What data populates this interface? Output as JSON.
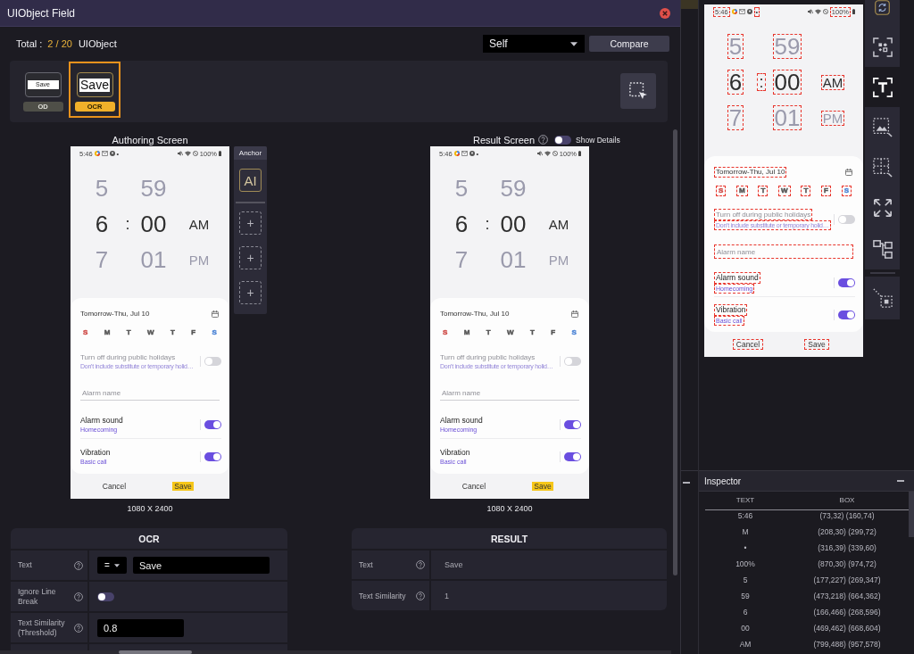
{
  "dialog": {
    "title": "UIObject Field",
    "total": {
      "label": "Total :",
      "count": "2 / 20",
      "unit": "UIObject"
    },
    "scope": {
      "value": "Self"
    },
    "compare_button": "Compare",
    "objects": [
      {
        "kind": "od",
        "image_text": "Save",
        "label": "OD",
        "selected": false
      },
      {
        "kind": "ocr",
        "image_text": "Save",
        "label": "OCR",
        "selected": true
      }
    ],
    "authoring": {
      "title": "Authoring Screen",
      "screen": {
        "ocr_boxes": false,
        "status": {
          "time": "5:46",
          "dot": "•",
          "battery": "100%"
        },
        "picker": {
          "separator": ":",
          "rows": [
            {
              "selected": false,
              "hour": "5",
              "minute": "59"
            },
            {
              "selected": true,
              "hour": "6",
              "minute": "00",
              "period": "AM"
            },
            {
              "selected": false,
              "hour": "7",
              "minute": "01",
              "period": "PM"
            }
          ]
        },
        "date": "Tomorrow-Thu, Jul 10",
        "days": [
          {
            "label": "S",
            "color": "#d0504c"
          },
          {
            "label": "M",
            "color": "#555555"
          },
          {
            "label": "T",
            "color": "#555555"
          },
          {
            "label": "W",
            "color": "#555555"
          },
          {
            "label": "T",
            "color": "#555555"
          },
          {
            "label": "F",
            "color": "#555555"
          },
          {
            "label": "S",
            "color": "#4f86d6"
          }
        ],
        "holiday": {
          "title": "Turn off during public holidays",
          "subtitle": "Don't include substitute or temporary holid…",
          "on": false,
          "disabled": true
        },
        "name_field": {
          "placeholder": "Alarm name"
        },
        "settings": [
          {
            "title": "Alarm sound",
            "subtitle": "Homecoming",
            "on": true
          },
          {
            "title": "Vibration",
            "subtitle": "Basic call",
            "on": true
          }
        ],
        "buttons": [
          {
            "label": "Cancel",
            "highlighted": false
          },
          {
            "label": "Save",
            "highlighted": true
          }
        ]
      },
      "resolution": "1080 X 2400"
    },
    "anchor": {
      "title": "Anchor",
      "ai_label": "AI",
      "slots": [
        "+",
        "+",
        "+"
      ]
    },
    "result": {
      "title": "Result Screen",
      "show_details": {
        "label": "Show Details",
        "on": false
      },
      "screen": {
        "ocr_boxes": false,
        "status": {
          "time": "5:46",
          "dot": "•",
          "battery": "100%"
        },
        "picker": {
          "separator": ":",
          "rows": [
            {
              "selected": false,
              "hour": "5",
              "minute": "59"
            },
            {
              "selected": true,
              "hour": "6",
              "minute": "00",
              "period": "AM"
            },
            {
              "selected": false,
              "hour": "7",
              "minute": "01",
              "period": "PM"
            }
          ]
        },
        "date": "Tomorrow-Thu, Jul 10",
        "days": [
          {
            "label": "S",
            "color": "#d0504c"
          },
          {
            "label": "M",
            "color": "#555555"
          },
          {
            "label": "T",
            "color": "#555555"
          },
          {
            "label": "W",
            "color": "#555555"
          },
          {
            "label": "T",
            "color": "#555555"
          },
          {
            "label": "F",
            "color": "#555555"
          },
          {
            "label": "S",
            "color": "#4f86d6"
          }
        ],
        "holiday": {
          "title": "Turn off during public holidays",
          "subtitle": "Don't include substitute or temporary holid…",
          "on": false,
          "disabled": true
        },
        "name_field": {
          "placeholder": "Alarm name"
        },
        "settings": [
          {
            "title": "Alarm sound",
            "subtitle": "Homecoming",
            "on": true
          },
          {
            "title": "Vibration",
            "subtitle": "Basic call",
            "on": true
          }
        ],
        "buttons": [
          {
            "label": "Cancel",
            "highlighted": false
          },
          {
            "label": "Save",
            "highlighted": true
          }
        ]
      },
      "resolution": "1080 X 2400"
    },
    "ocr_panel": {
      "title": "OCR",
      "rows": [
        {
          "kind": "operator_text",
          "label": "Text",
          "operator": "=",
          "value": "Save"
        },
        {
          "kind": "toggle",
          "label": "Ignore Line Break",
          "on": false
        },
        {
          "kind": "input",
          "label": "Text Similarity (Threshold)",
          "value": "0.8"
        }
      ]
    },
    "result_panel": {
      "title": "RESULT",
      "rows": [
        {
          "label": "Text",
          "value": "Save"
        },
        {
          "label": "Text Similarity",
          "value": "1"
        }
      ]
    }
  },
  "device": {
    "screen": {
      "ocr_boxes": true,
      "status": {
        "time": "5:46",
        "dot": "•",
        "battery": "100%"
      },
      "picker": {
        "separator": ":",
        "rows": [
          {
            "selected": false,
            "hour": "5",
            "minute": "59"
          },
          {
            "selected": true,
            "hour": "6",
            "minute": "00",
            "period": "AM"
          },
          {
            "selected": false,
            "hour": "7",
            "minute": "01",
            "period": "PM"
          }
        ]
      },
      "date": "Tomorrow-Thu, Jul 10",
      "days": [
        {
          "label": "S",
          "color": "#d0504c"
        },
        {
          "label": "M",
          "color": "#555555"
        },
        {
          "label": "T",
          "color": "#555555"
        },
        {
          "label": "W",
          "color": "#555555"
        },
        {
          "label": "T",
          "color": "#555555"
        },
        {
          "label": "F",
          "color": "#555555"
        },
        {
          "label": "S",
          "color": "#4f86d6"
        }
      ],
      "holiday": {
        "title": "Turn off during public holidays",
        "subtitle": "Don't include substitute or temporary holid…",
        "on": false,
        "disabled": true
      },
      "name_field": {
        "placeholder": "Alarm name"
      },
      "settings": [
        {
          "title": "Alarm sound",
          "subtitle": "Homecoming",
          "on": true
        },
        {
          "title": "Vibration",
          "subtitle": "Basic call",
          "on": true
        }
      ],
      "buttons": [
        {
          "label": "Cancel",
          "highlighted": false
        },
        {
          "label": "Save",
          "highlighted": false
        }
      ]
    }
  },
  "tools": [
    {
      "kind": "rotate",
      "selected": false,
      "divider_before": false
    },
    {
      "kind": "object-scan",
      "selected": false,
      "divider_before": false
    },
    {
      "kind": "text-select",
      "selected": true,
      "divider_before": false
    },
    {
      "kind": "image-select",
      "selected": false,
      "divider_before": false
    },
    {
      "kind": "grid-select",
      "selected": false,
      "divider_before": false
    },
    {
      "kind": "expand",
      "selected": false,
      "divider_before": false
    },
    {
      "kind": "hierarchy",
      "selected": false,
      "divider_before": false
    },
    {
      "kind": "region-select",
      "selected": false,
      "divider_before": true
    }
  ],
  "inspector": {
    "title": "Inspector",
    "columns": [
      "TEXT",
      "BOX"
    ],
    "rows": [
      {
        "text": "5:46",
        "box": "(73,32) (160,74)"
      },
      {
        "text": "M",
        "box": "(208,30) (299,72)"
      },
      {
        "text": "•",
        "box": "(316,39) (339,60)"
      },
      {
        "text": "100%",
        "box": "(870,30) (974,72)"
      },
      {
        "text": "5",
        "box": "(177,227) (269,347)"
      },
      {
        "text": "59",
        "box": "(473,218) (664,362)"
      },
      {
        "text": "6",
        "box": "(166,466) (268,596)"
      },
      {
        "text": "00",
        "box": "(469,462) (668,604)"
      },
      {
        "text": "AM",
        "box": "(799,488) (957,578)"
      }
    ]
  }
}
